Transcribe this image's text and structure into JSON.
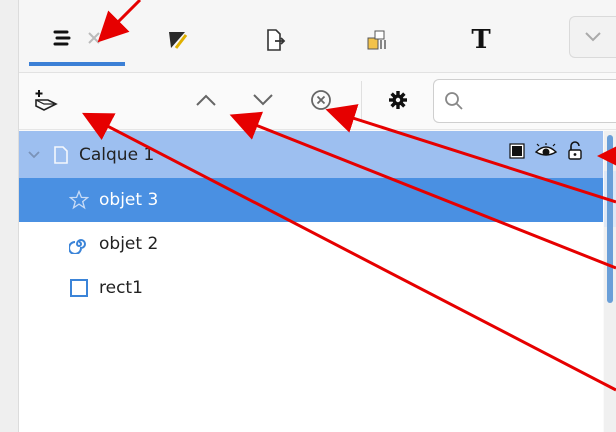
{
  "tabs": [
    {
      "id": "objects",
      "icon": "objects-list-icon",
      "active": true
    },
    {
      "id": "fill-stroke",
      "icon": "fill-stroke-icon"
    },
    {
      "id": "export",
      "icon": "export-icon"
    },
    {
      "id": "align",
      "icon": "align-distribute-icon"
    },
    {
      "id": "text",
      "icon": "text-font-icon",
      "glyph": "T"
    }
  ],
  "toolbar": {
    "search_placeholder": "",
    "icons": [
      "add-layer-icon",
      "move-up-icon",
      "move-down-icon",
      "remove-icon",
      "settings-icon",
      "search-icon"
    ]
  },
  "tree": {
    "layer": {
      "label": "Calque 1"
    },
    "items": [
      {
        "label": "objet 3",
        "icon": "star-icon",
        "selected": true
      },
      {
        "label": "objet 2",
        "icon": "spiral-icon",
        "selected": false
      },
      {
        "label": "rect1",
        "icon": "rectangle-icon",
        "selected": false
      }
    ]
  },
  "colors": {
    "accent": "#4a90e2",
    "layer_row": "#9dbff0",
    "arrow": "#e60000"
  }
}
